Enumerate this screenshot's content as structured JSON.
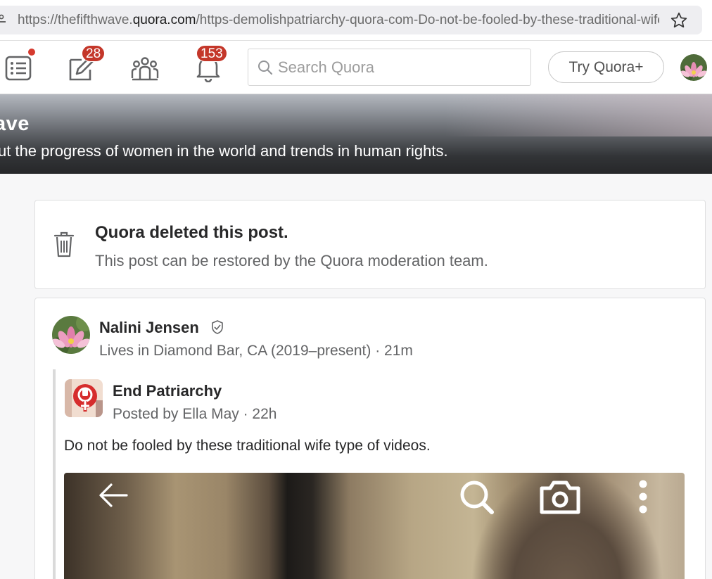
{
  "browser": {
    "url_prefix": "https://thefifthwave.",
    "url_host": "quora.com",
    "url_path": "/https-demolishpatriarchy-quora-com-Do-not-be-fooled-by-these-traditional-wife-type-of-videos"
  },
  "header": {
    "answer_badge": "28",
    "notifications_badge": "153",
    "search_placeholder": "Search Quora",
    "try_plus_label": "Try Quora+"
  },
  "space": {
    "title_partial": "ave",
    "description_partial": "ut the progress of women in the world and trends in human rights."
  },
  "deleted_post": {
    "title": "Quora deleted this post.",
    "subtitle": "This post can be restored by the Quora moderation team."
  },
  "post": {
    "author_name": "Nalini Jensen",
    "author_credential": "Lives in Diamond Bar, CA (2019–present) · 21m",
    "shared_space_name": "End Patriarchy",
    "shared_meta": "Posted by Ella May  · 22h",
    "text": "Do not be fooled by these traditional wife type of videos."
  },
  "colors": {
    "badge_red": "#c4372a",
    "text_primary": "#282829",
    "text_secondary": "#636466"
  },
  "icons": [
    "lock-icon",
    "star-icon",
    "feed-icon",
    "write-icon",
    "spaces-icon",
    "bell-icon",
    "search-icon",
    "trash-icon",
    "shield-check-icon",
    "back-arrow-icon",
    "magnify-icon",
    "camera-icon",
    "more-icon"
  ]
}
